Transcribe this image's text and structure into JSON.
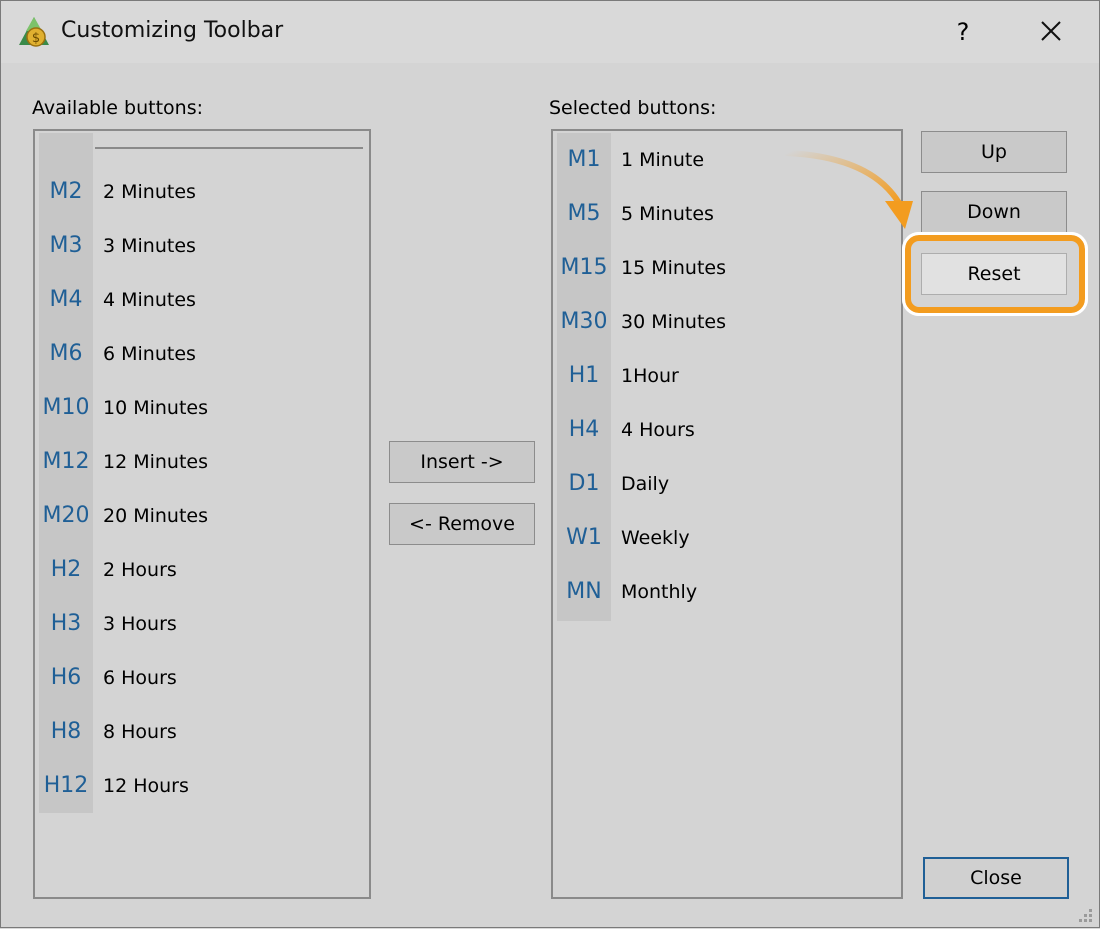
{
  "window": {
    "title": "Customizing Toolbar",
    "help_label": "?"
  },
  "available": {
    "label": "Available buttons:",
    "items": [
      {
        "code": "M2",
        "name": "2 Minutes"
      },
      {
        "code": "M3",
        "name": "3 Minutes"
      },
      {
        "code": "M4",
        "name": "4 Minutes"
      },
      {
        "code": "M6",
        "name": "6 Minutes"
      },
      {
        "code": "M10",
        "name": "10 Minutes"
      },
      {
        "code": "M12",
        "name": "12 Minutes"
      },
      {
        "code": "M20",
        "name": "20 Minutes"
      },
      {
        "code": "H2",
        "name": "2 Hours"
      },
      {
        "code": "H3",
        "name": "3 Hours"
      },
      {
        "code": "H6",
        "name": "6 Hours"
      },
      {
        "code": "H8",
        "name": "8 Hours"
      },
      {
        "code": "H12",
        "name": "12 Hours"
      }
    ]
  },
  "selected": {
    "label": "Selected buttons:",
    "items": [
      {
        "code": "M1",
        "name": "1 Minute"
      },
      {
        "code": "M5",
        "name": "5 Minutes"
      },
      {
        "code": "M15",
        "name": "15 Minutes"
      },
      {
        "code": "M30",
        "name": "30 Minutes"
      },
      {
        "code": "H1",
        "name": "1Hour"
      },
      {
        "code": "H4",
        "name": "4 Hours"
      },
      {
        "code": "D1",
        "name": "Daily"
      },
      {
        "code": "W1",
        "name": "Weekly"
      },
      {
        "code": "MN",
        "name": "Monthly"
      }
    ]
  },
  "buttons": {
    "insert": "Insert ->",
    "remove": "<- Remove",
    "up": "Up",
    "down": "Down",
    "reset": "Reset",
    "close": "Close"
  },
  "colors": {
    "code_text": "#1f5f96",
    "highlight": "#f39c1f",
    "default_button_border": "#1f5f96"
  }
}
